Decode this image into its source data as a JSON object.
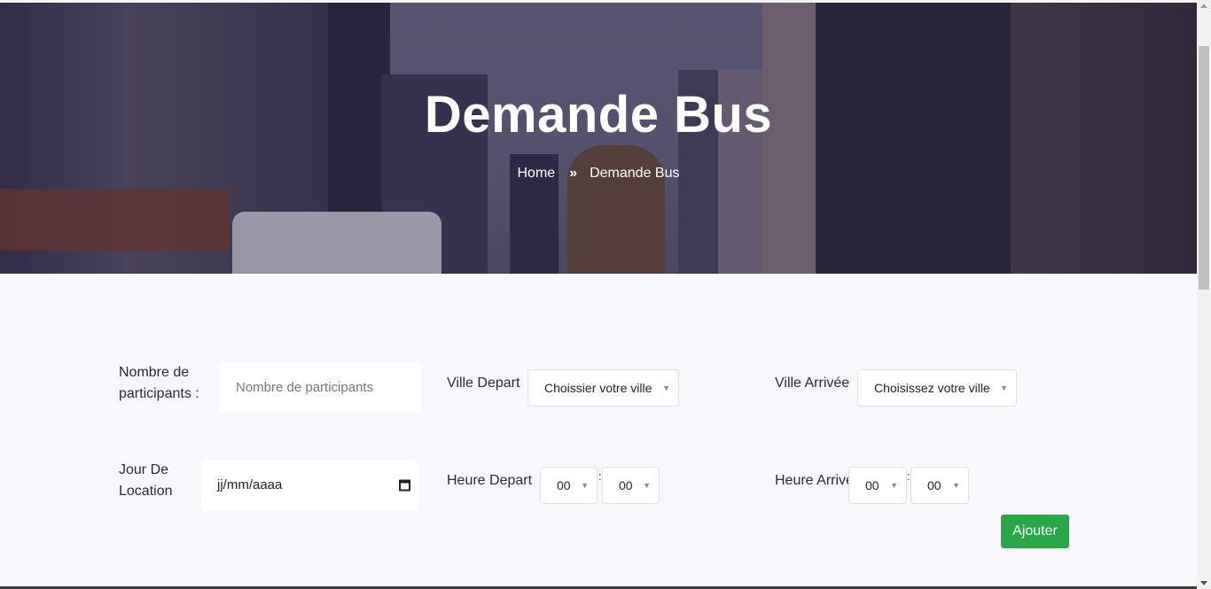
{
  "hero": {
    "title": "Demande Bus",
    "breadcrumb": {
      "home": "Home",
      "separator": "»",
      "current": "Demande Bus"
    }
  },
  "form": {
    "participants": {
      "label": "Nombre de participants :",
      "placeholder": "Nombre de participants"
    },
    "ville_depart": {
      "label": "Ville Depart",
      "selected": "Choissier votre ville"
    },
    "ville_arrivee": {
      "label": "Ville Arrivée",
      "selected": "Choisissez votre ville"
    },
    "jour": {
      "label": "Jour De Location",
      "placeholder": "jj/mm/aaaa"
    },
    "heure_depart": {
      "label": "Heure Depart",
      "hour": "00",
      "minute": "00",
      "separator": ":"
    },
    "heure_arrivee": {
      "label": "Heure Arrivée",
      "hour": "00",
      "minute": "00",
      "separator": ":"
    },
    "submit_label": "Ajouter"
  },
  "colors": {
    "accent_button": "#28a745",
    "page_background": "#f7f7fc",
    "hero_overlay": "#2d2a44"
  },
  "icons": [
    "calendar-icon",
    "chevron-down-icon",
    "scroll-up-arrow-icon",
    "scroll-down-arrow-icon"
  ]
}
